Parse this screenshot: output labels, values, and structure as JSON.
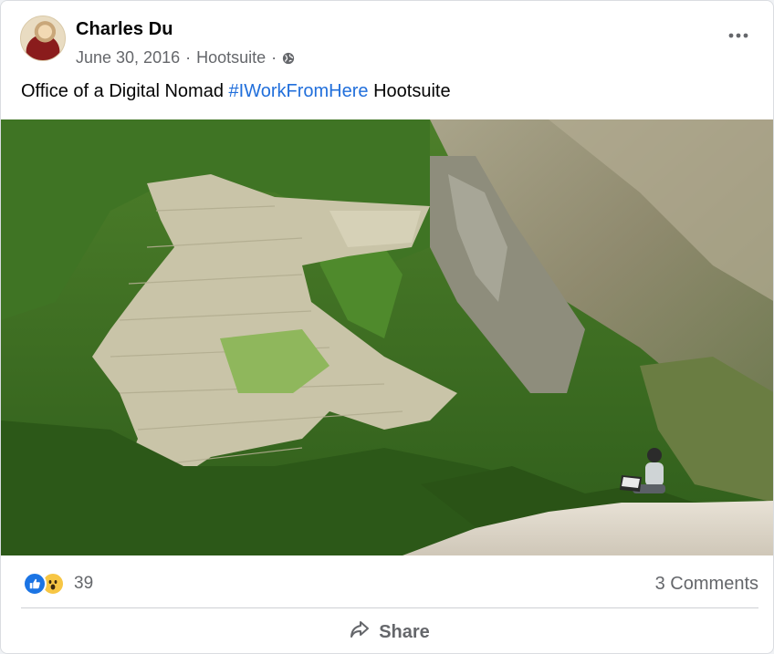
{
  "post": {
    "author": "Charles Du",
    "date": "June 30, 2016",
    "separator": " · ",
    "source": "Hootsuite",
    "audience_icon": "globe-icon",
    "menu_icon": "more-icon",
    "caption": {
      "before": "Office of a Digital Nomad ",
      "hashtag": "#IWorkFromHere",
      "after": " Hootsuite"
    }
  },
  "reactions": {
    "icons": [
      "like-icon",
      "wow-icon"
    ],
    "count": "39",
    "comments": "3 Comments"
  },
  "actions": {
    "share_label": "Share",
    "share_icon": "share-icon"
  },
  "colors": {
    "link": "#216fdb",
    "like": "#1b74e4",
    "wow": "#f7c644",
    "muted_text": "#65676b"
  }
}
